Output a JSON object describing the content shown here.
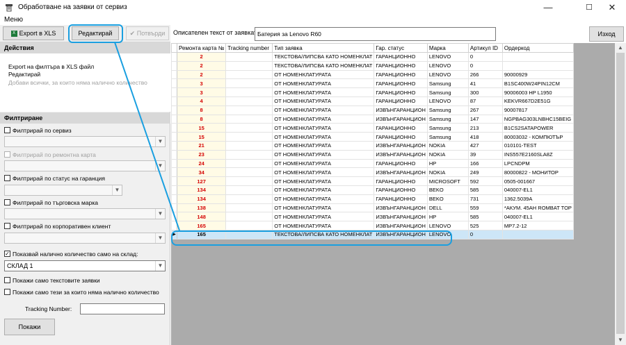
{
  "window": {
    "title": "Обработване на заявки от сервиз"
  },
  "menu": {
    "items": [
      "Меню"
    ]
  },
  "toolbar": {
    "export_label": "Export в XLS",
    "edit_label": "Редактирай",
    "confirm_label": "Потвърди"
  },
  "description": {
    "label": "Описателен текст от заявката:",
    "value": "Батерия за Lenovo R60"
  },
  "exit_label": "Изход",
  "actions": {
    "header": "Действия",
    "items": [
      "Export на филтъра в XLS файл",
      "Редактирай",
      "Добави всички, за които няма налично количество"
    ]
  },
  "filters": {
    "header": "Филтриране",
    "by_service": "Филтрирай по сервиз",
    "by_repair_card": "Филтрирай по ремонтна карта",
    "by_warranty_status": "Филтрирай по статус на гаранция",
    "by_brand": "Филтрирай по търговска марка",
    "by_corporate_client": "Филтрирай по корпоративен клиент",
    "show_warehouse_qty": "Показвай налично количество само на склад:",
    "warehouse_value": "СКЛАД 1",
    "text_only": "Покажи само текстовите заявки",
    "no_qty_only": "Покажи само тези за които няма налично количество",
    "tracking_label": "Tracking Number:",
    "tracking_value": "",
    "show_button": "Покажи"
  },
  "grid": {
    "columns": [
      "Ремонта карта №",
      "Tracking number",
      "Тип заявка",
      "Гар. статус",
      "Марка",
      "Артикул ID",
      "Ордеркод"
    ],
    "rows": [
      [
        "2",
        "",
        "ТЕКСТОВА/ЛИПСВА КАТО НОМЕНКЛАТ",
        "ГАРАНЦИОННО",
        "LENOVO",
        "0",
        ""
      ],
      [
        "2",
        "",
        "ТЕКСТОВА/ЛИПСВА КАТО НОМЕНКЛАТ",
        "ГАРАНЦИОННО",
        "LENOVO",
        "0",
        ""
      ],
      [
        "2",
        "",
        "ОТ НОМЕНКЛАТУРАТА",
        "ГАРАНЦИОННО",
        "LENOVO",
        "266",
        "90000929"
      ],
      [
        "3",
        "",
        "ОТ НОМЕНКЛАТУРАТА",
        "ГАРАНЦИОННО",
        "Samsung",
        "41",
        "B1SC400W24PIN12CM"
      ],
      [
        "3",
        "",
        "ОТ НОМЕНКЛАТУРАТА",
        "ГАРАНЦИОННО",
        "Samsung",
        "300",
        "90006003 HP L1950"
      ],
      [
        "4",
        "",
        "ОТ НОМЕНКЛАТУРАТА",
        "ГАРАНЦИОННО",
        "LENOVO",
        "87",
        "KEKVR667D2E51G"
      ],
      [
        "8",
        "",
        "ОТ НОМЕНКЛАТУРАТА",
        "ИЗВЪНГАРАНЦИОН",
        "Samsung",
        "267",
        "90007817"
      ],
      [
        "8",
        "",
        "ОТ НОМЕНКЛАТУРАТА",
        "ИЗВЪНГАРАНЦИОН",
        "Samsung",
        "147",
        "NGPBAG303LNBHC15BEIG"
      ],
      [
        "15",
        "",
        "ОТ НОМЕНКЛАТУРАТА",
        "ГАРАНЦИОННО",
        "Samsung",
        "213",
        "B1CS2SATAPOWER"
      ],
      [
        "15",
        "",
        "ОТ НОМЕНКЛАТУРАТА",
        "ГАРАНЦИОННО",
        "Samsung",
        "418",
        "80003032 - КОМПЮТЪР"
      ],
      [
        "21",
        "",
        "ОТ НОМЕНКЛАТУРАТА",
        "ИЗВЪНГАРАНЦИОН",
        "NOKIA",
        "427",
        "010101-TEST"
      ],
      [
        "23",
        "",
        "ОТ НОМЕНКЛАТУРАТА",
        "ИЗВЪНГАРАНЦИОН",
        "NOKIA",
        "39",
        "INS557E2160SLA8Z"
      ],
      [
        "24",
        "",
        "ОТ НОМЕНКЛАТУРАТА",
        "ГАРАНЦИОННО",
        "HP",
        "166",
        "LPCNDPM"
      ],
      [
        "34",
        "",
        "ОТ НОМЕНКЛАТУРАТА",
        "ИЗВЪНГАРАНЦИОН",
        "NOKIA",
        "249",
        "80000822 - МОНИТОР"
      ],
      [
        "127",
        "",
        "ОТ НОМЕНКЛАТУРАТА",
        "ГАРАНЦИОННО",
        "MICROSOFT",
        "592",
        "0505-001667"
      ],
      [
        "134",
        "",
        "ОТ НОМЕНКЛАТУРАТА",
        "ГАРАНЦИОННО",
        "BEKO",
        "585",
        "040007-EL1"
      ],
      [
        "134",
        "",
        "ОТ НОМЕНКЛАТУРАТА",
        "ГАРАНЦИОННО",
        "BEKO",
        "731",
        "1362.5039A"
      ],
      [
        "138",
        "",
        "ОТ НОМЕНКЛАТУРАТА",
        "ИЗВЪНГАРАНЦИОН",
        "DELL",
        "559",
        "*АКУМ. 45AH ROMBAT TOP"
      ],
      [
        "148",
        "",
        "ОТ НОМЕНКЛАТУРАТА",
        "ИЗВЪНГАРАНЦИОН",
        "HP",
        "585",
        "040007-EL1"
      ],
      [
        "165",
        "",
        "ОТ НОМЕНКЛАТУРАТА",
        "ИЗВЪНГАРАНЦИОН",
        "LENOVO",
        "525",
        "MP7.2-12"
      ],
      [
        "165",
        "",
        "ТЕКСТОВА/ЛИПСВА КАТО НОМЕНКЛАТ",
        "ИЗВЪНГАРАНЦИОН",
        "LENOVO",
        "0",
        ""
      ]
    ],
    "selected_row": 20
  },
  "colors": {
    "annotation": "#1a9fe0",
    "repair_text": "#d40000",
    "selected_row": "#cde6f7"
  }
}
